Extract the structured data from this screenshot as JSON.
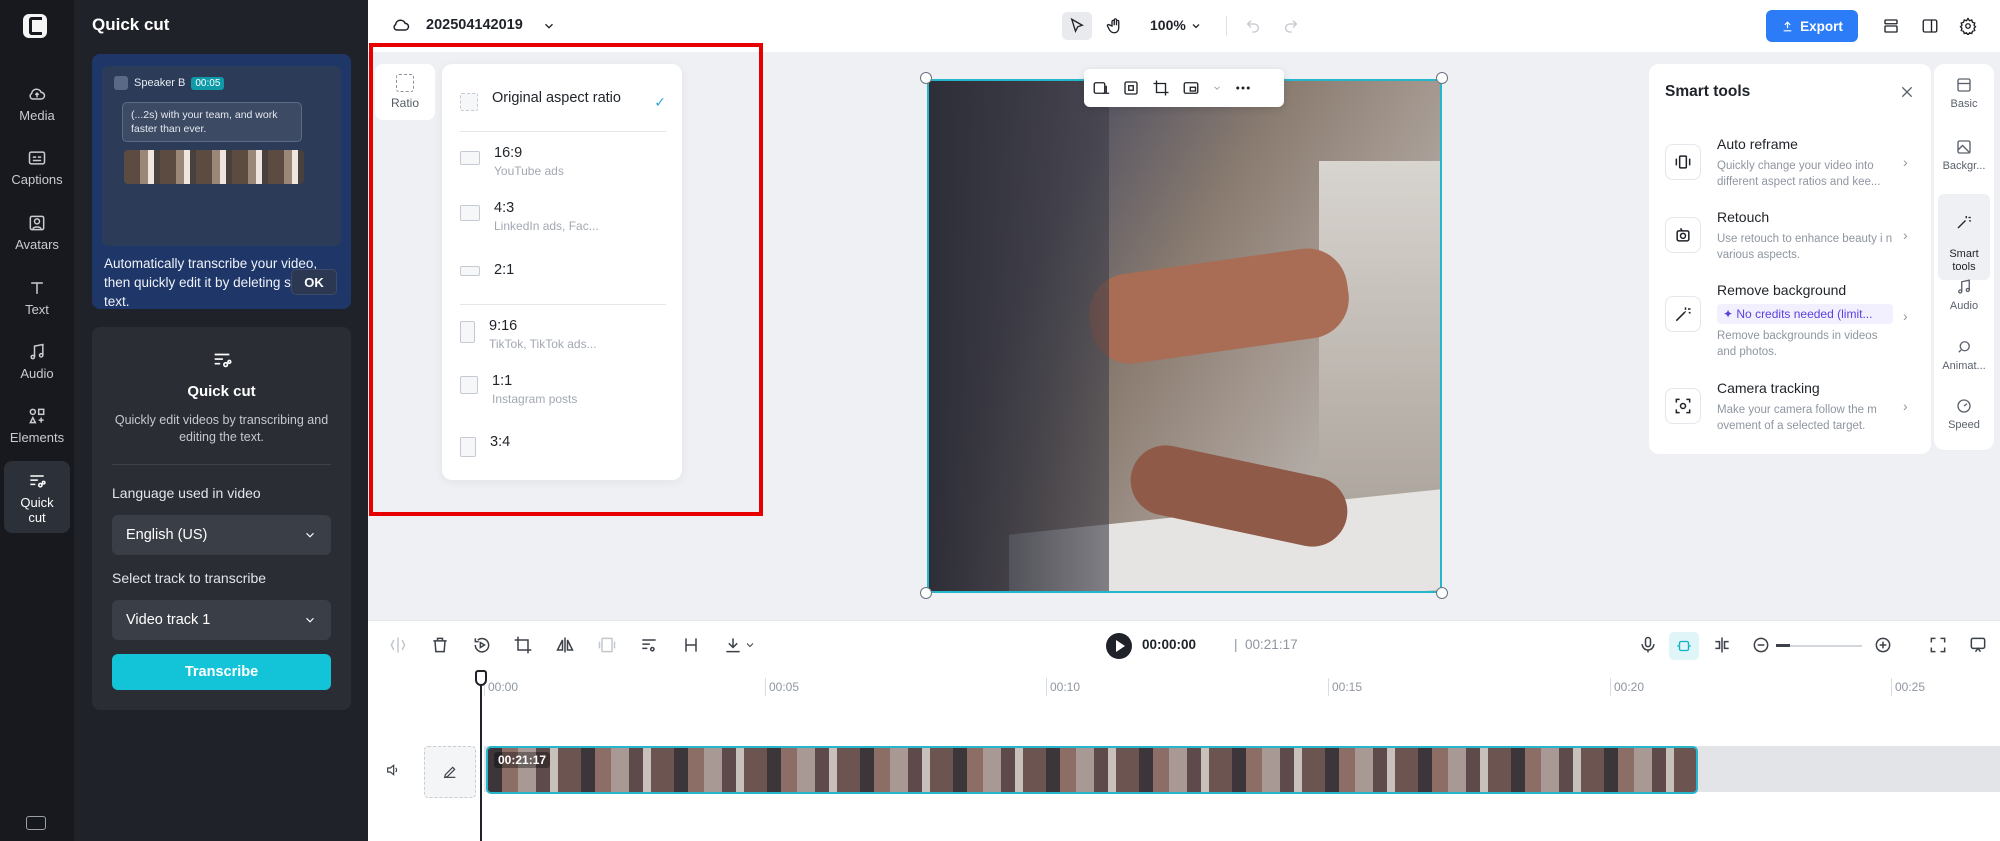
{
  "rail": {
    "items": [
      {
        "label": "Media",
        "icon": "cloud-icon"
      },
      {
        "label": "Captions",
        "icon": "captions-icon"
      },
      {
        "label": "Avatars",
        "icon": "avatar-icon"
      },
      {
        "label": "Text",
        "icon": "text-icon"
      },
      {
        "label": "Audio",
        "icon": "music-note-icon"
      },
      {
        "label": "Elements",
        "icon": "elements-icon"
      },
      {
        "label": "Quick\ncut",
        "icon": "quick-cut-icon"
      }
    ]
  },
  "panel": {
    "title": "Quick cut",
    "tip": {
      "speaker": "Speaker B",
      "timecode": "00:05",
      "bubble": "(...2s) with your team, and work faster than ever.",
      "description": "Automatically transcribe your video, then quickly edit it by deleting selected text.",
      "ok": "OK"
    },
    "card": {
      "title": "Quick cut",
      "subtitle": "Quickly edit videos by transcribing and editing the text.",
      "language_label": "Language used in video",
      "language_value": "English (US)",
      "track_label": "Select track to transcribe",
      "track_value": "Video track 1",
      "transcribe": "Transcribe"
    }
  },
  "topbar": {
    "project": "202504142019",
    "zoom": "100%",
    "export": "Export"
  },
  "ratio": {
    "side_label": "Ratio",
    "items": [
      {
        "title": "Original aspect ratio",
        "sub": "",
        "selected": true
      },
      {
        "title": "16:9",
        "sub": "YouTube ads"
      },
      {
        "title": "4:3",
        "sub": "LinkedIn ads, Fac..."
      },
      {
        "title": "2:1",
        "sub": ""
      },
      {
        "title": "9:16",
        "sub": "TikTok, TikTok ads..."
      },
      {
        "title": "1:1",
        "sub": "Instagram posts"
      },
      {
        "title": "3:4",
        "sub": ""
      }
    ]
  },
  "smart": {
    "title": "Smart tools",
    "tools": [
      {
        "name": "Auto reframe",
        "desc": "Quickly change your video into different aspect ratios and kee..."
      },
      {
        "name": "Retouch",
        "desc": "Use retouch to enhance beauty i n various aspects."
      },
      {
        "name": "Remove background",
        "credit": "✦ No credits needed (limit...",
        "desc": "Remove backgrounds in videos and photos."
      },
      {
        "name": "Camera tracking",
        "desc": "Make your camera follow the m ovement of a selected target."
      }
    ]
  },
  "rside": {
    "items": [
      "Basic",
      "Backgr...",
      "Smart\ntools",
      "Audio",
      "Animat...",
      "Speed"
    ]
  },
  "timeline": {
    "current": "00:00:00",
    "separator": "|",
    "duration": "00:21:17",
    "ticks": [
      "00:00",
      "00:05",
      "00:10",
      "00:15",
      "00:20",
      "00:25"
    ],
    "clip_label": "00:21:17"
  },
  "colors": {
    "accent": "#13c4d8",
    "export": "#2b7cf6",
    "highlight": "#e60000"
  }
}
